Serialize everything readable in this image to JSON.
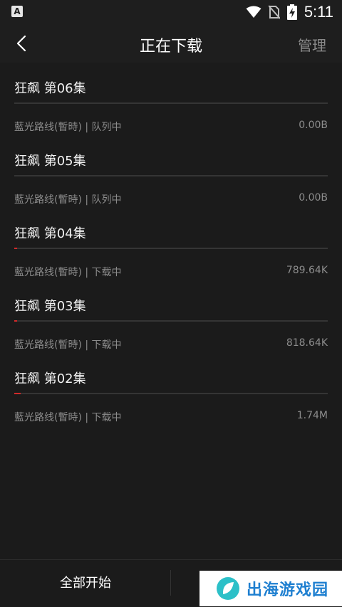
{
  "status_bar": {
    "time": "5:11"
  },
  "header": {
    "title": "正在下载",
    "manage_label": "管理"
  },
  "downloads": [
    {
      "title": "狂飙 第06集",
      "status": "藍光路线(暫時) | 队列中",
      "size": "0.00B",
      "progress": 0.0
    },
    {
      "title": "狂飙 第05集",
      "status": "藍光路线(暫時) | 队列中",
      "size": "0.00B",
      "progress": 0.0
    },
    {
      "title": "狂飙 第04集",
      "status": "藍光路线(暫時) | 下载中",
      "size": "789.64K",
      "progress": 0.01
    },
    {
      "title": "狂飙 第03集",
      "status": "藍光路线(暫時) | 下载中",
      "size": "818.64K",
      "progress": 0.01
    },
    {
      "title": "狂飙 第02集",
      "status": "藍光路线(暫時) | 下载中",
      "size": "1.74M",
      "progress": 0.02
    }
  ],
  "bottom_bar": {
    "start_all_label": "全部开始"
  },
  "watermark": {
    "text": "出海游戏园"
  },
  "colors": {
    "accent": "#d02a2a",
    "background": "#1b1b1b",
    "watermark": "#1e7fd0"
  },
  "icons": {
    "back": "chevron-left-icon",
    "wifi": "wifi-icon",
    "no_sim": "no-sim-icon",
    "battery": "battery-charging-icon"
  }
}
